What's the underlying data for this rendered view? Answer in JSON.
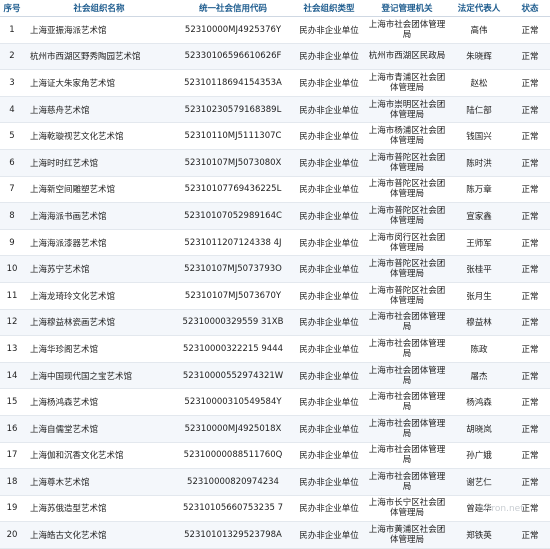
{
  "headers": {
    "num": "序号",
    "name": "社会组织名称",
    "code": "统一社会信用代码",
    "type": "社会组织类型",
    "authority": "登记管理机关",
    "rep": "法定代表人",
    "status": "状态"
  },
  "rows": [
    {
      "num": "1",
      "name": "上海亚振海派艺术馆",
      "code": "52310000MJ4925376Y",
      "type": "民办非企业单位",
      "authority": "上海市社会团体管理局",
      "rep": "高伟",
      "status": "正常"
    },
    {
      "num": "2",
      "name": "杭州市西湖区野秀陶园艺术馆",
      "code": "52330106596610626F",
      "type": "民办非企业单位",
      "authority": "杭州市西湖区民政局",
      "rep": "朱晓辉",
      "status": "正常"
    },
    {
      "num": "3",
      "name": "上海证大朱家角艺术馆",
      "code": "52310118694154353A",
      "type": "民办非企业单位",
      "authority": "上海市青浦区社会团体管理局",
      "rep": "赵松",
      "status": "正常"
    },
    {
      "num": "4",
      "name": "上海慈舟艺术馆",
      "code": "52310230579168389L",
      "type": "民办非企业单位",
      "authority": "上海市崇明区社会团体管理局",
      "rep": "陆仁部",
      "status": "正常"
    },
    {
      "num": "5",
      "name": "上海乾璇视艺文化艺术馆",
      "code": "52310110MJ5111307C",
      "type": "民办非企业单位",
      "authority": "上海市杨浦区社会团体管理局",
      "rep": "钱国兴",
      "status": "正常"
    },
    {
      "num": "6",
      "name": "上海时时红艺术馆",
      "code": "52310107MJ5073080X",
      "type": "民办非企业单位",
      "authority": "上海市普陀区社会团体管理局",
      "rep": "陈时洪",
      "status": "正常"
    },
    {
      "num": "7",
      "name": "上海新空间雕塑艺术馆",
      "code": "52310107769436225L",
      "type": "民办非企业单位",
      "authority": "上海市普陀区社会团体管理局",
      "rep": "陈万章",
      "status": "正常"
    },
    {
      "num": "8",
      "name": "上海海派书画艺术馆",
      "code": "52310107052989164C",
      "type": "民办非企业单位",
      "authority": "上海市普陀区社会团体管理局",
      "rep": "宣家鑫",
      "status": "正常"
    },
    {
      "num": "9",
      "name": "上海海派漆器艺术馆",
      "code": "5231011207124338 4J",
      "type": "民办非企业单位",
      "authority": "上海市闵行区社会团体管理局",
      "rep": "王师军",
      "status": "正常"
    },
    {
      "num": "10",
      "name": "上海苏宁艺术馆",
      "code": "52310107MJ5073793O",
      "type": "民办非企业单位",
      "authority": "上海市普陀区社会团体管理局",
      "rep": "张桂平",
      "status": "正常"
    },
    {
      "num": "11",
      "name": "上海龙琦玲文化艺术馆",
      "code": "52310107MJ5073670Y",
      "type": "民办非企业单位",
      "authority": "上海市普陀区社会团体管理局",
      "rep": "张月生",
      "status": "正常"
    },
    {
      "num": "12",
      "name": "上海穆益林瓷画艺术馆",
      "code": "52310000329559 31XB",
      "type": "民办非企业单位",
      "authority": "上海市社会团体管理局",
      "rep": "穆益林",
      "status": "正常"
    },
    {
      "num": "13",
      "name": "上海华珍阁艺术馆",
      "code": "52310000322215 9444",
      "type": "民办非企业单位",
      "authority": "上海市社会团体管理局",
      "rep": "陈政",
      "status": "正常"
    },
    {
      "num": "14",
      "name": "上海中国现代国之宝艺术馆",
      "code": "52310000552974321W",
      "type": "民办非企业单位",
      "authority": "上海市社会团体管理局",
      "rep": "屠杰",
      "status": "正常"
    },
    {
      "num": "15",
      "name": "上海杨鸿森艺术馆",
      "code": "52310000310549584Y",
      "type": "民办非企业单位",
      "authority": "上海市社会团体管理局",
      "rep": "杨鸿森",
      "status": "正常"
    },
    {
      "num": "16",
      "name": "上海自儒堂艺术馆",
      "code": "52310000MJ4925018X",
      "type": "民办非企业单位",
      "authority": "上海市社会团体管理局",
      "rep": "胡晓岚",
      "status": "正常"
    },
    {
      "num": "17",
      "name": "上海伽和沉香文化艺术馆",
      "code": "52310000088511760Q",
      "type": "民办非企业单位",
      "authority": "上海市社会团体管理局",
      "rep": "孙广娥",
      "status": "正常"
    },
    {
      "num": "18",
      "name": "上海尊木艺术馆",
      "code": "52310000820974234",
      "type": "民办非企业单位",
      "authority": "上海市社会团体管理局",
      "rep": "谢艺仁",
      "status": "正常"
    },
    {
      "num": "19",
      "name": "上海苏俄造型艺术馆",
      "code": "52310105660753235 7",
      "type": "民办非企业单位",
      "authority": "上海市长宁区社会团体管理局",
      "rep": "曾建华",
      "status": "正常"
    },
    {
      "num": "20",
      "name": "上海皓古文化艺术馆",
      "code": "52310101329523798A",
      "type": "民办非企业单位",
      "authority": "上海市黄浦区社会团体管理局",
      "rep": "郑铁英",
      "status": "正常"
    }
  ],
  "watermark": "Artron.net"
}
